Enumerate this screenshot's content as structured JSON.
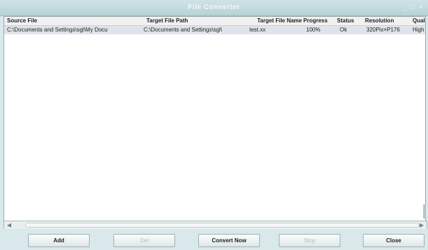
{
  "window": {
    "title": "File Converter",
    "controls": [
      "minimize-icon",
      "maximize-icon",
      "close-icon"
    ]
  },
  "table": {
    "columns": [
      "Source File",
      "Target File Path",
      "Target File Name",
      "Progress",
      "Status",
      "Resolution",
      "Quality"
    ],
    "rows": [
      {
        "source_file": "C:\\Documents and Settings\\sgl\\My Docu",
        "target_path": "C:\\Documents and Settings\\sgl\\",
        "target_name": "test.xx",
        "progress": "100%",
        "status": "Ok",
        "resolution": "320Pix×P176",
        "quality": "High"
      }
    ]
  },
  "buttons": {
    "add": "Add",
    "del": "Del",
    "convert": "Convert Now",
    "stop": "Stop",
    "close": "Close"
  }
}
